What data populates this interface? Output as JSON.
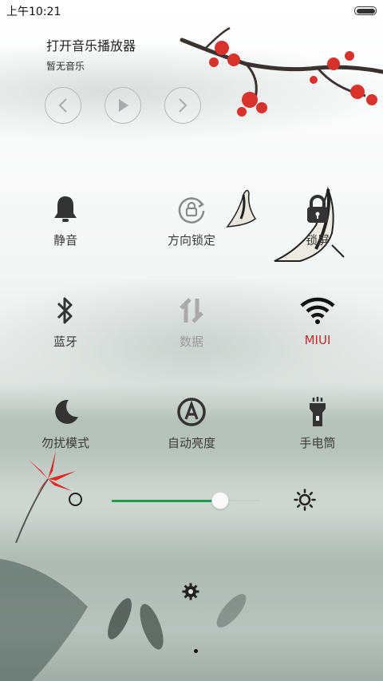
{
  "status_bar": {
    "time": "上午10:21"
  },
  "music": {
    "title": "打开音乐播放器",
    "subtitle": "暂无音乐",
    "controls": [
      "previous",
      "play",
      "next"
    ]
  },
  "toggles": [
    {
      "label": "静音",
      "icon": "bell-icon",
      "state": "off"
    },
    {
      "label": "方向锁定",
      "icon": "rotation-lock-icon",
      "state": "off"
    },
    {
      "label": "锁屏",
      "icon": "lock-icon",
      "state": "off"
    },
    {
      "label": "蓝牙",
      "icon": "bluetooth-icon",
      "state": "off"
    },
    {
      "label": "数据",
      "icon": "mobile-data-icon",
      "state": "disabled"
    },
    {
      "label": "MIUI",
      "icon": "wifi-icon",
      "state": "on"
    },
    {
      "label": "勿扰模式",
      "icon": "moon-icon",
      "state": "off"
    },
    {
      "label": "自动亮度",
      "icon": "auto-brightness-icon",
      "state": "off"
    },
    {
      "label": "手电筒",
      "icon": "flashlight-icon",
      "state": "off"
    }
  ],
  "brightness": {
    "level": 0.73
  },
  "colors": {
    "active": "#c7262c",
    "slider": "#1e9d4c",
    "inactive": "#9a9a9a"
  }
}
